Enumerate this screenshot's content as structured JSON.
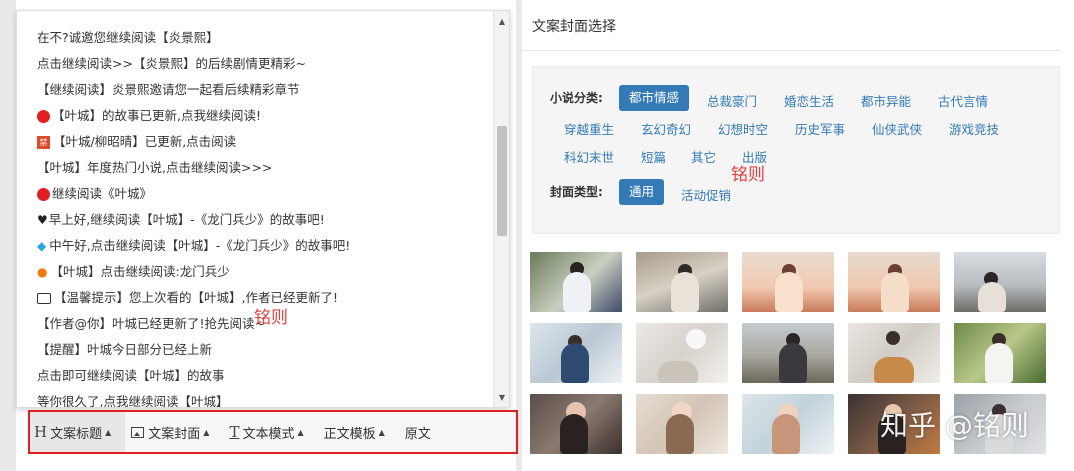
{
  "dropdown": {
    "items": [
      {
        "text": "在不?诚邀您继续阅读【炎景熙】",
        "icon": "none"
      },
      {
        "text": "点击继续阅读>>【炎景熙】的后续剧情更精彩~",
        "icon": "none"
      },
      {
        "text": "【继续阅读】炎景熙邀请您一起看后续精彩章节",
        "icon": "none"
      },
      {
        "text": "【叶城】的故事已更新,点我继续阅读!",
        "icon": "red-dot-icon"
      },
      {
        "text": "【叶城/柳昭晴】已更新,点击阅读",
        "icon": "ban-icon"
      },
      {
        "text": "【叶城】年度热门小说,点击继续阅读>>>",
        "icon": "none"
      },
      {
        "text": "继续阅读《叶城》",
        "icon": "red-dot-icon"
      },
      {
        "text": "早上好,继续阅读【叶城】-《龙门兵少》的故事吧!",
        "icon": "heart-icon"
      },
      {
        "text": "中午好,点击继续阅读【叶城】-《龙门兵少》的故事吧!",
        "icon": "gem-icon"
      },
      {
        "text": "【叶城】点击继续阅读:龙门兵少",
        "icon": "fire-icon"
      },
      {
        "text": "【温馨提示】您上次看的【叶城】,作者已经更新了!",
        "icon": "book-icon"
      },
      {
        "text": "【作者@你】叶城已经更新了!抢先阅读~",
        "icon": "none"
      },
      {
        "text": "【提醒】叶城今日部分已经上新",
        "icon": "none"
      },
      {
        "text": "点击即可继续阅读【叶城】的故事",
        "icon": "none"
      },
      {
        "text": "等你很久了,点我继续阅读【叶城】",
        "icon": "none"
      }
    ],
    "ban_glyph": "禁",
    "watermark": "铭则"
  },
  "toolbar": {
    "title_label": "文案标题",
    "cover_label": "文案封面",
    "text_mode_label": "文本模式",
    "body_template_label": "正文模板",
    "source_label": "原文",
    "title_icon_glyph": "H",
    "text_icon_glyph": "T"
  },
  "cover_panel": {
    "title": "文案封面选择",
    "category_label": "小说分类:",
    "categories": [
      "都市情感",
      "总裁豪门",
      "婚恋生活",
      "都市异能",
      "古代言情",
      "穿越重生",
      "玄幻奇幻",
      "幻想时空",
      "历史军事",
      "仙侠武侠",
      "游戏竞技",
      "科幻末世",
      "短篇",
      "其它",
      "出版"
    ],
    "active_category": "都市情感",
    "type_label": "封面类型:",
    "types": [
      "通用",
      "活动促销"
    ],
    "active_type": "通用",
    "watermark": "铭则"
  },
  "colors": {
    "accent": "#337ab7",
    "highlight_border": "#e02020",
    "watermark": "#e02020"
  },
  "site_watermark": "知乎 @铭则"
}
